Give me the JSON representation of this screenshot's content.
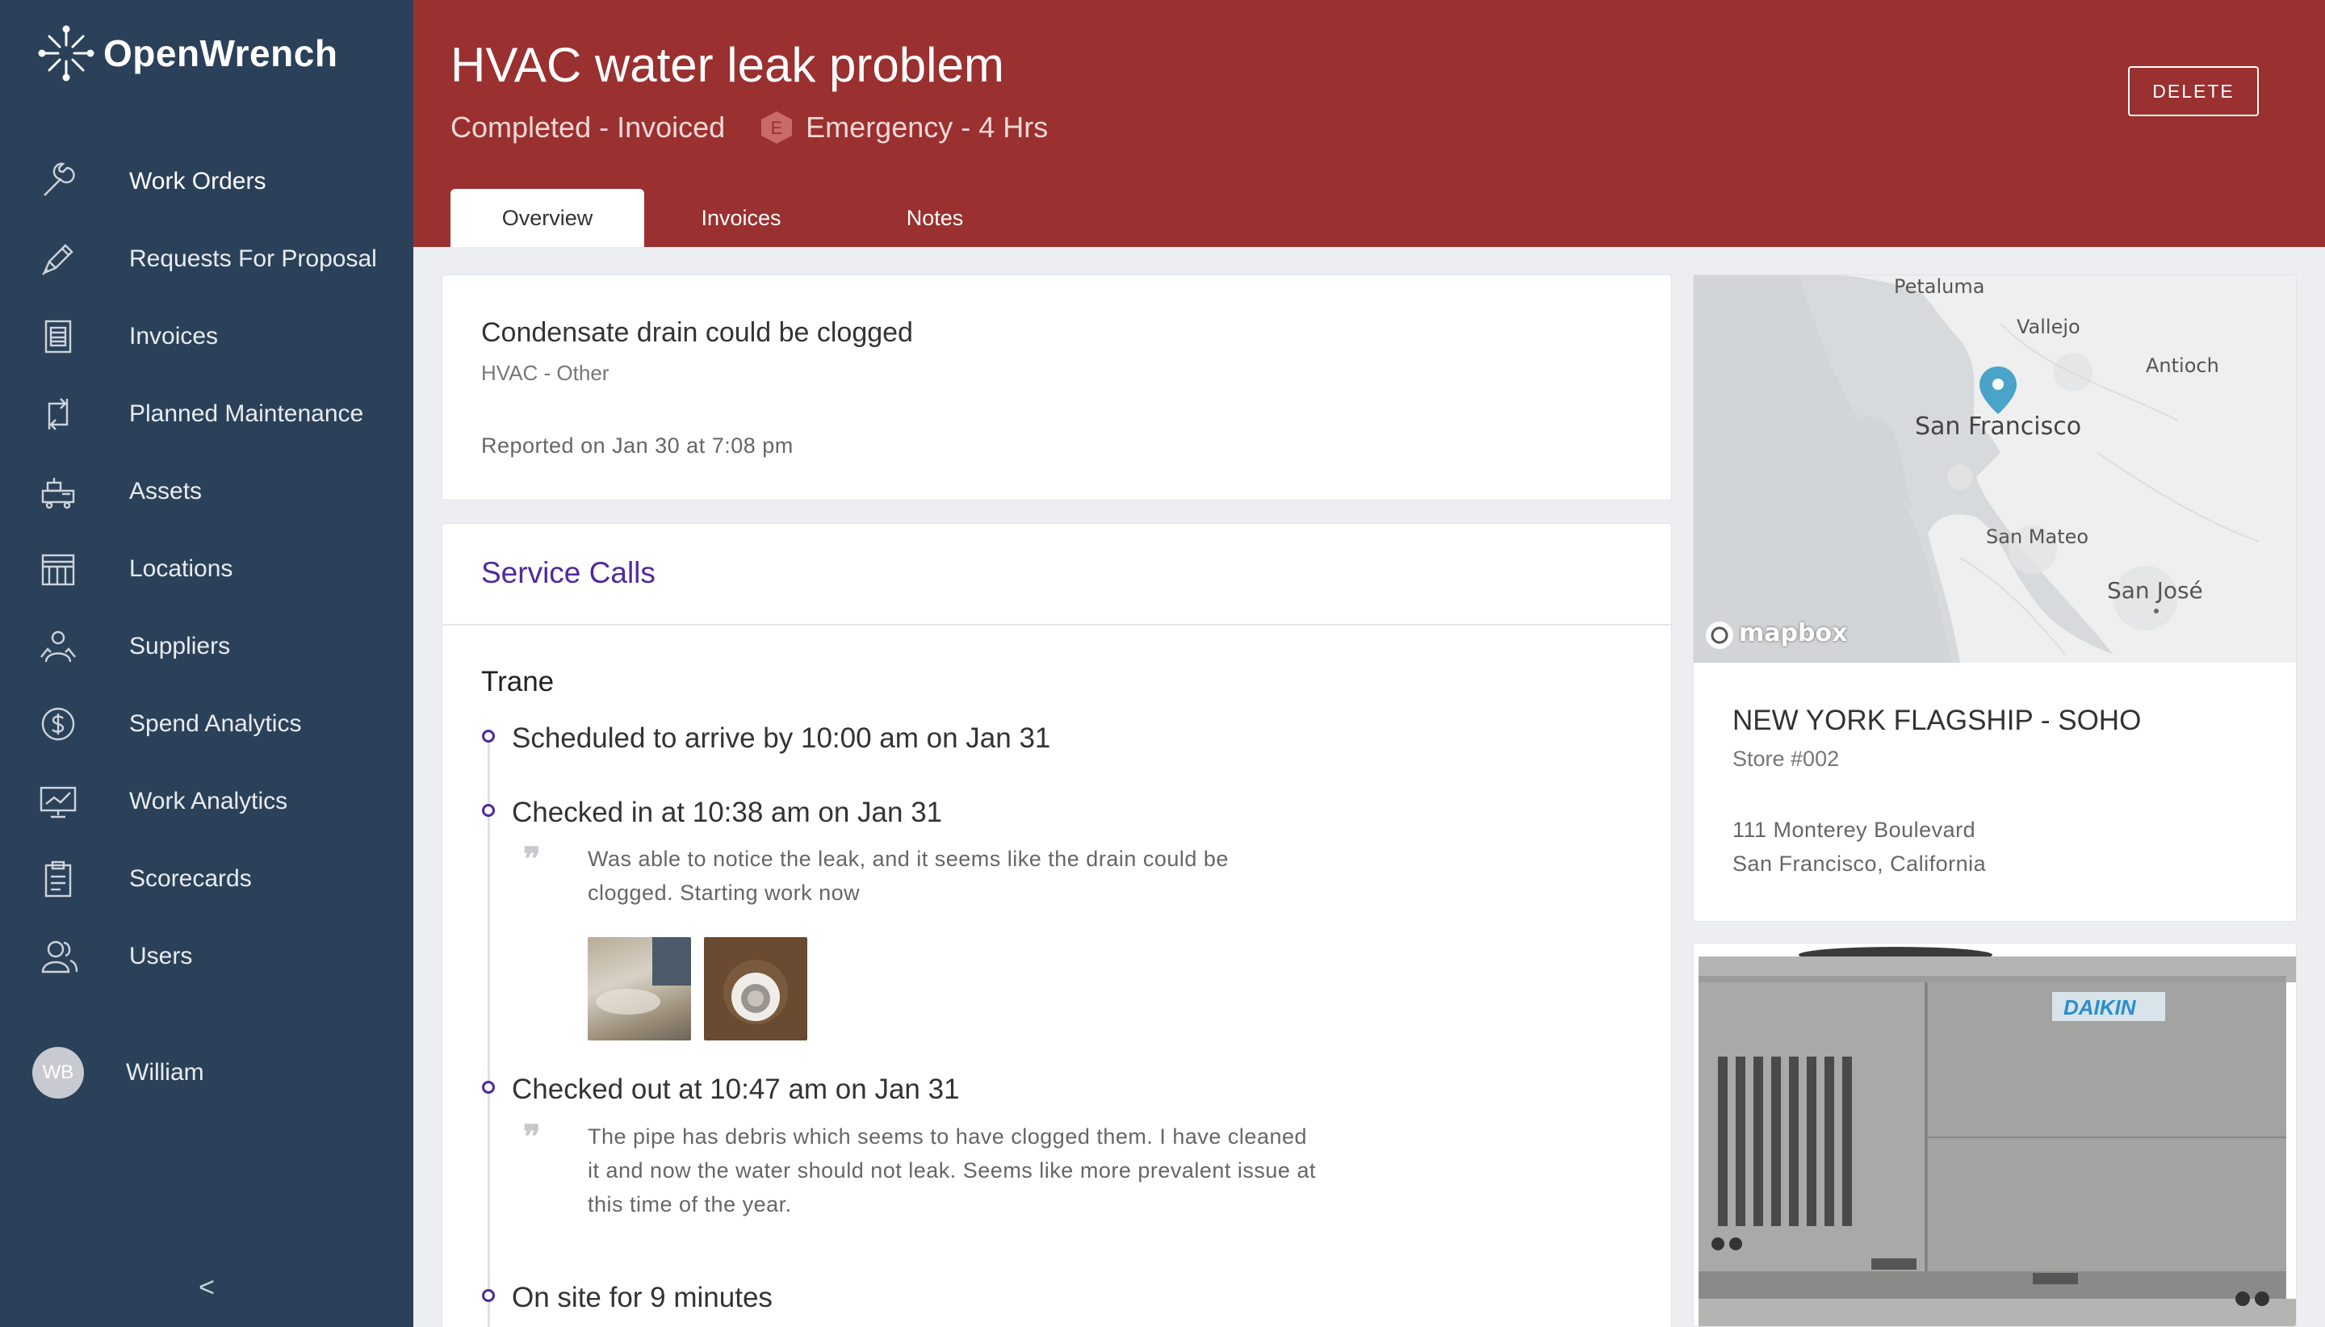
{
  "brand": {
    "name": "OpenWrench",
    "icon": "openwrench-logo-icon"
  },
  "sidebar": {
    "items": [
      {
        "label": "Work Orders",
        "icon": "wrench-icon",
        "active": true
      },
      {
        "label": "Requests For Proposal",
        "icon": "pen-icon"
      },
      {
        "label": "Invoices",
        "icon": "invoice-icon"
      },
      {
        "label": "Planned Maintenance",
        "icon": "recurring-icon"
      },
      {
        "label": "Assets",
        "icon": "equipment-icon"
      },
      {
        "label": "Locations",
        "icon": "store-icon"
      },
      {
        "label": "Suppliers",
        "icon": "suppliers-icon"
      },
      {
        "label": "Spend Analytics",
        "icon": "dollar-icon"
      },
      {
        "label": "Work Analytics",
        "icon": "presentation-chart-icon"
      },
      {
        "label": "Scorecards",
        "icon": "clipboard-icon"
      },
      {
        "label": "Users",
        "icon": "users-icon"
      }
    ],
    "user": {
      "initials": "WB",
      "name": "William"
    },
    "collapse_label": "<"
  },
  "header": {
    "title": "HVAC water leak problem",
    "status": "Completed - Invoiced",
    "priority_badge": "E",
    "priority": "Emergency - 4 Hrs",
    "delete_label": "DELETE",
    "tabs": [
      {
        "label": "Overview",
        "active": true
      },
      {
        "label": "Invoices"
      },
      {
        "label": "Notes"
      }
    ]
  },
  "problem": {
    "title": "Condensate drain could be clogged",
    "category": "HVAC - Other",
    "reported": "Reported on Jan 30 at 7:08 pm"
  },
  "service_calls": {
    "heading": "Service Calls",
    "vendor": "Trane",
    "events": [
      {
        "text": "Scheduled to arrive by 10:00 am on Jan 31"
      },
      {
        "text": "Checked in at 10:38 am on Jan 31",
        "note_lines": [
          "Was able to notice the leak, and it seems like the drain could be",
          "clogged. Starting work now"
        ]
      },
      {
        "text": "Checked out at 10:47 am on Jan 31",
        "note_lines": [
          "The pipe has debris which seems to have clogged them. I have cleaned",
          "it and now the water should not leak. Seems like more prevalent issue at",
          "this time of the year."
        ]
      },
      {
        "text": "On site for 9 minutes"
      }
    ]
  },
  "location": {
    "map_labels": [
      "Petaluma",
      "Vallejo",
      "Antioch",
      "San Francisco",
      "San Mateo",
      "San José"
    ],
    "map_attribution": "mapbox",
    "name": "NEW YORK FLAGSHIP - SOHO",
    "store": "Store #002",
    "address_line1": "111 Monterey Boulevard",
    "address_line2": "San Francisco, California"
  },
  "asset": {
    "brand_label": "DAIKIN"
  },
  "colors": {
    "header": "#9a302f",
    "sidebar": "#2b4159",
    "accent": "#4e2a9e"
  }
}
